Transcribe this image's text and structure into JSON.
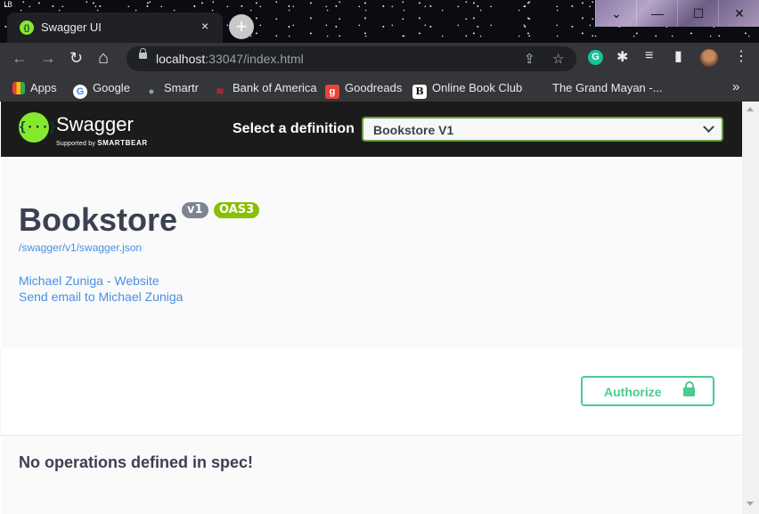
{
  "corner_logo": "LB",
  "tab": {
    "title": "Swagger UI",
    "close": "×",
    "favicon": "{}"
  },
  "newtab_glyph": "+",
  "window_controls": {
    "dropdown": "⌄",
    "minimize": "—",
    "maximize": "☐",
    "close": "✕"
  },
  "toolbar": {
    "back": "←",
    "forward": "→",
    "reload": "↻",
    "home": "⌂",
    "url_host": "localhost",
    "url_rest": ":33047/index.html",
    "share_icon": "⇪",
    "star_icon": "☆",
    "ext_grammarly": "G",
    "ext_puzzle": "✱",
    "ext_media": "≡",
    "ext_sidepanel": "▮",
    "menu": "⋮"
  },
  "bookmarks": {
    "items": [
      {
        "label": "Apps",
        "icon": "apps-grid-icon"
      },
      {
        "label": "Google",
        "icon": "google-icon",
        "glyph": "G"
      },
      {
        "label": "Smartr",
        "icon": "globe-icon",
        "glyph": "●"
      },
      {
        "label": "Bank of America",
        "icon": "bofa-icon",
        "glyph": "≋"
      },
      {
        "label": "Goodreads",
        "icon": "goodreads-icon",
        "glyph": "g"
      },
      {
        "label": "Online Book Club",
        "icon": "book-club-icon",
        "glyph": "B"
      },
      {
        "label": "The Grand Mayan -...",
        "icon": "none"
      }
    ],
    "overflow": "»"
  },
  "swagger": {
    "logo_glyph": "{···}",
    "name": "Swagger",
    "supported_by": "Supported by",
    "smartbear": "SMARTBEAR",
    "select_label": "Select a definition",
    "selected_definition": "Bookstore V1"
  },
  "info": {
    "title": "Bookstore",
    "version_badge": "v1",
    "oas_badge": "OAS3",
    "spec_url": "/swagger/v1/swagger.json",
    "website_link": "Michael Zuniga - Website",
    "email_link": "Send email to Michael Zuniga"
  },
  "authorize": {
    "label": "Authorize"
  },
  "operations": {
    "empty_message": "No operations defined in spec!"
  },
  "colors": {
    "swagger_green": "#85ea2d",
    "select_border": "#62a03f",
    "badge_version": "#7d8492",
    "badge_oas": "#89bf04",
    "link": "#4990e2",
    "authorize": "#49cc90",
    "text": "#3b4151"
  }
}
